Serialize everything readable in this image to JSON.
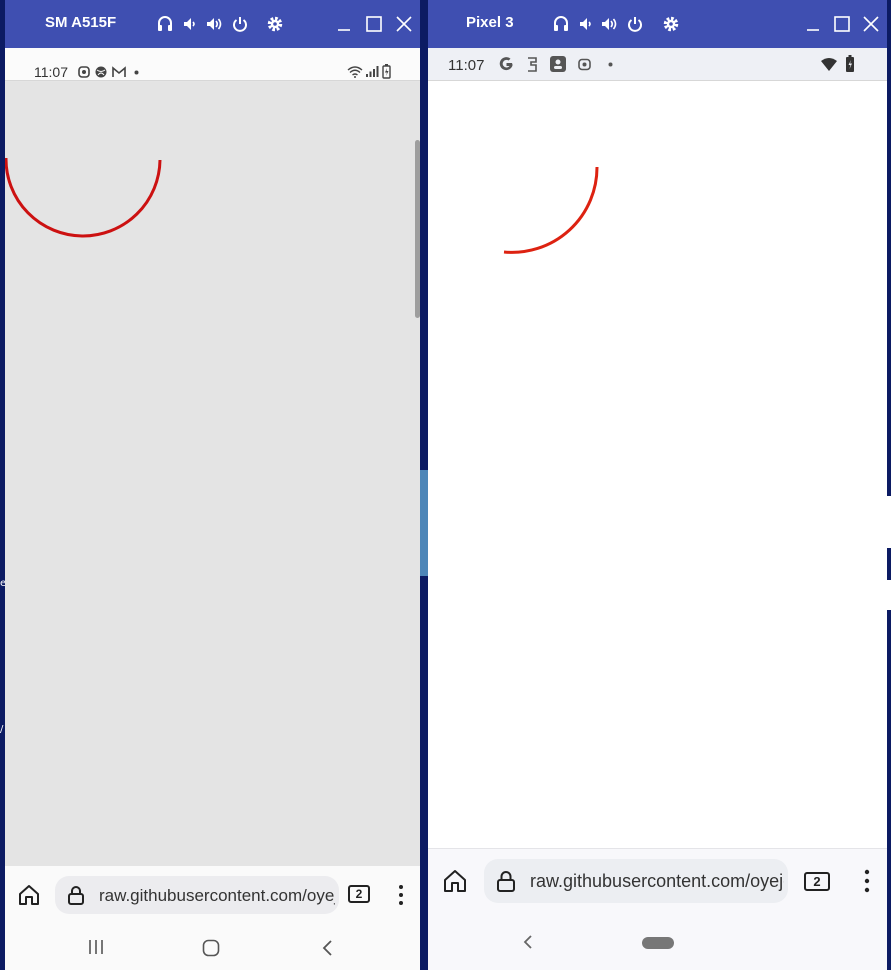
{
  "devices": [
    {
      "window_title": "SM A515F",
      "status_time": "11:07",
      "status_icons": [
        "vpn-shield-icon",
        "circle-app-icon",
        "gmail-icon",
        "dot-icon",
        "wifi-icon",
        "cell-signal-icon",
        "battery-icon"
      ],
      "url": "raw.githubusercontent.com/oyej",
      "tab_count": "2",
      "title_icons": [
        "headphones-icon",
        "volume-down-icon",
        "volume-up-icon",
        "power-icon",
        "settings-icon",
        "minimize-icon",
        "maximize-icon",
        "close-icon"
      ],
      "nav_buttons": [
        "recents-button",
        "home-button",
        "back-button"
      ],
      "arc_color": "#cc1111"
    },
    {
      "window_title": "Pixel 3",
      "status_time": "11:07",
      "status_icons": [
        "google-icon",
        "notification-icon",
        "app-icon",
        "vpn-shield-icon",
        "dot-icon",
        "wifi-icon",
        "battery-icon"
      ],
      "url": "raw.githubusercontent.com/oyejo",
      "tab_count": "2",
      "title_icons": [
        "headphones-icon",
        "volume-down-icon",
        "volume-up-icon",
        "power-icon",
        "settings-icon",
        "minimize-icon",
        "maximize-icon",
        "close-icon"
      ],
      "nav_buttons": [
        "back-button",
        "home-pill-button"
      ],
      "arc_color": "#dd2211"
    }
  ],
  "colors": {
    "desktop": "#0c1b63",
    "titlebar": "#3f4fb1",
    "device_a_content": "#e4e4e4",
    "device_b_content": "#ffffff"
  },
  "edge_fragments": [
    "e",
    "/"
  ]
}
